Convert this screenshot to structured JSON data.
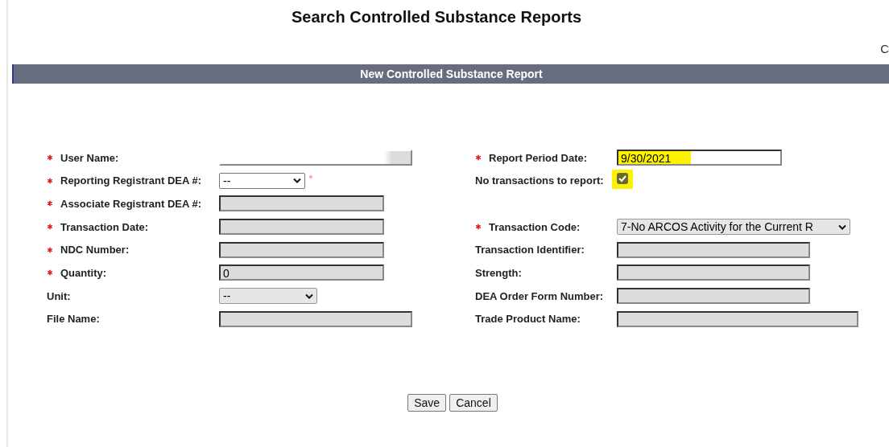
{
  "page_title": "Search Controlled Substance Reports",
  "corner_text": "C",
  "section_header": "New Controlled Substance Report",
  "rows": [
    {
      "left": {
        "label": "User Name:",
        "required": true,
        "kind": "text",
        "disabled": false,
        "autofill": true
      },
      "right": {
        "label": "Report Period Date:",
        "required": true,
        "kind": "text",
        "value": "9/30/2021",
        "disabled": false,
        "highlighted": true
      }
    },
    {
      "left": {
        "label": "Reporting Registrant DEA #:",
        "required": true,
        "kind": "select",
        "value": "--",
        "disabled": false,
        "trailing_required": true
      },
      "right": {
        "label": "No transactions to report:",
        "required": false,
        "kind": "checkbox",
        "checked": true,
        "highlighted": true
      }
    },
    {
      "left": {
        "label": "Associate Registrant DEA #:",
        "required": true,
        "kind": "text",
        "disabled": true
      }
    },
    {
      "left": {
        "label": "Transaction Date:",
        "required": true,
        "kind": "text",
        "disabled": true
      },
      "right": {
        "label": "Transaction Code:",
        "required": true,
        "kind": "select",
        "value": "7-No ARCOS Activity for the Current R",
        "disabled": true
      }
    },
    {
      "left": {
        "label": "NDC Number:",
        "required": true,
        "kind": "text",
        "disabled": true
      },
      "right": {
        "label": "Transaction Identifier:",
        "required": false,
        "kind": "text",
        "disabled": true
      }
    },
    {
      "left": {
        "label": "Quantity:",
        "required": true,
        "kind": "text",
        "value": "0",
        "disabled": true
      },
      "right": {
        "label": "Strength:",
        "required": false,
        "kind": "text",
        "disabled": true
      }
    },
    {
      "left": {
        "label": "Unit:",
        "required": false,
        "kind": "select",
        "value": "--",
        "disabled": true
      },
      "right": {
        "label": "DEA Order Form Number:",
        "required": false,
        "kind": "text",
        "disabled": true
      }
    },
    {
      "left": {
        "label": "File Name:",
        "required": false,
        "kind": "text",
        "disabled": true
      },
      "right": {
        "label": "Trade Product Name:",
        "required": false,
        "kind": "text",
        "disabled": true
      }
    }
  ],
  "buttons": [
    "Save",
    "Cancel"
  ]
}
